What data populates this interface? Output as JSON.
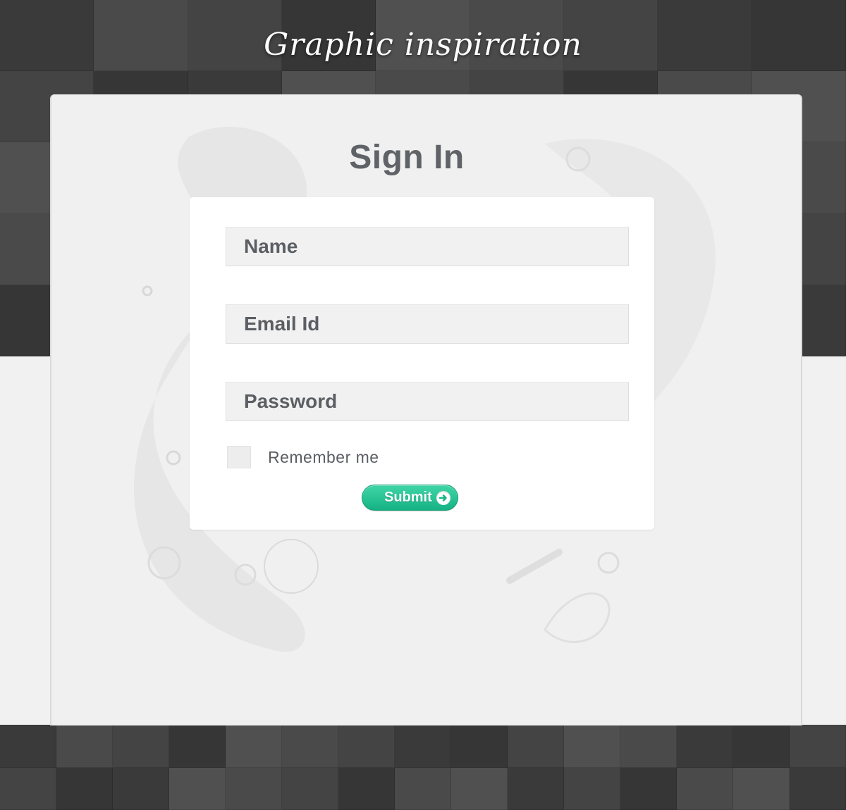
{
  "brand": {
    "title": "Graphic inspiration"
  },
  "page": {
    "heading": "Sign In"
  },
  "form": {
    "name_placeholder": "Name",
    "email_placeholder": "Email Id",
    "password_placeholder": "Password",
    "remember_label": "Remember me",
    "remember_checked": false,
    "submit_label": "Submit",
    "submit_icon": "arrow-right-icon"
  },
  "colors": {
    "accent": "#1bbf8d",
    "heading": "#5f6266",
    "background": "#f1f1f1",
    "mosaic": "#3d3d3d"
  }
}
